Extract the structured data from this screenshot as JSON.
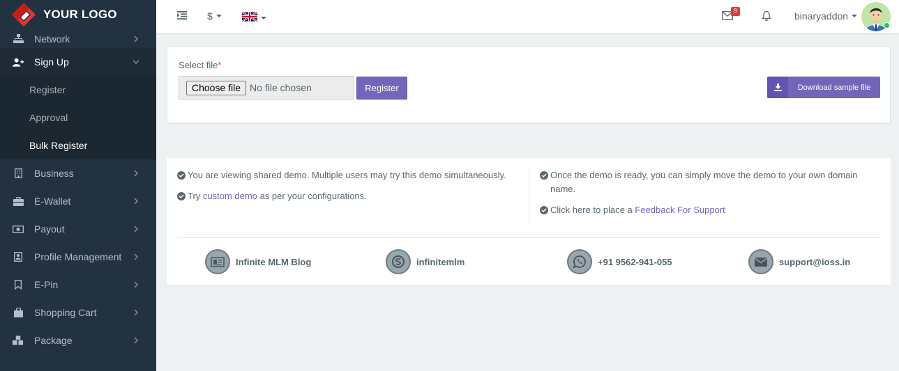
{
  "brand": {
    "logo_text": "YOUR LOGO",
    "accent": "#7266ba",
    "sidebar_bg": "#233240"
  },
  "sidebar": {
    "items": [
      {
        "label": "Network",
        "icon": "sitemap-icon"
      },
      {
        "label": "Sign Up",
        "icon": "user-plus-icon",
        "expanded": true,
        "children": [
          {
            "label": "Register"
          },
          {
            "label": "Approval"
          },
          {
            "label": "Bulk Register",
            "current": true
          }
        ]
      },
      {
        "label": "Business",
        "icon": "building-icon"
      },
      {
        "label": "E-Wallet",
        "icon": "briefcase-icon"
      },
      {
        "label": "Payout",
        "icon": "money-icon"
      },
      {
        "label": "Profile Management",
        "icon": "address-book-icon"
      },
      {
        "label": "E-Pin",
        "icon": "bookmark-icon"
      },
      {
        "label": "Shopping Cart",
        "icon": "shopping-bag-icon"
      },
      {
        "label": "Package",
        "icon": "cubes-icon"
      }
    ]
  },
  "header": {
    "currency": "$",
    "language_icon": "uk-flag-icon",
    "mail_badge": "9",
    "username": "binaryaddon"
  },
  "upload": {
    "label": "Select file",
    "required_mark": "*",
    "choose_label": "Choose file",
    "no_file_text": "No file chosen",
    "register_label": "Register",
    "download_label": "Download sample file"
  },
  "info": {
    "line1": "You are viewing shared demo. Multiple users may try this demo simultaneously.",
    "line2_prefix": "Try ",
    "line2_link": "custom demo",
    "line2_suffix": " as per your configurations.",
    "line3": "Once the demo is ready, you can simply move the demo to your own domain name.",
    "line4_prefix": "Click here to place a ",
    "line4_link": "Feedback For Support"
  },
  "contacts": [
    {
      "icon": "newspaper-icon",
      "text": "Infinite MLM Blog"
    },
    {
      "icon": "skype-icon",
      "text": "infinitemlm"
    },
    {
      "icon": "whatsapp-icon",
      "text": "+91 9562-941-055"
    },
    {
      "icon": "envelope-icon",
      "text": "support@ioss.in"
    }
  ]
}
